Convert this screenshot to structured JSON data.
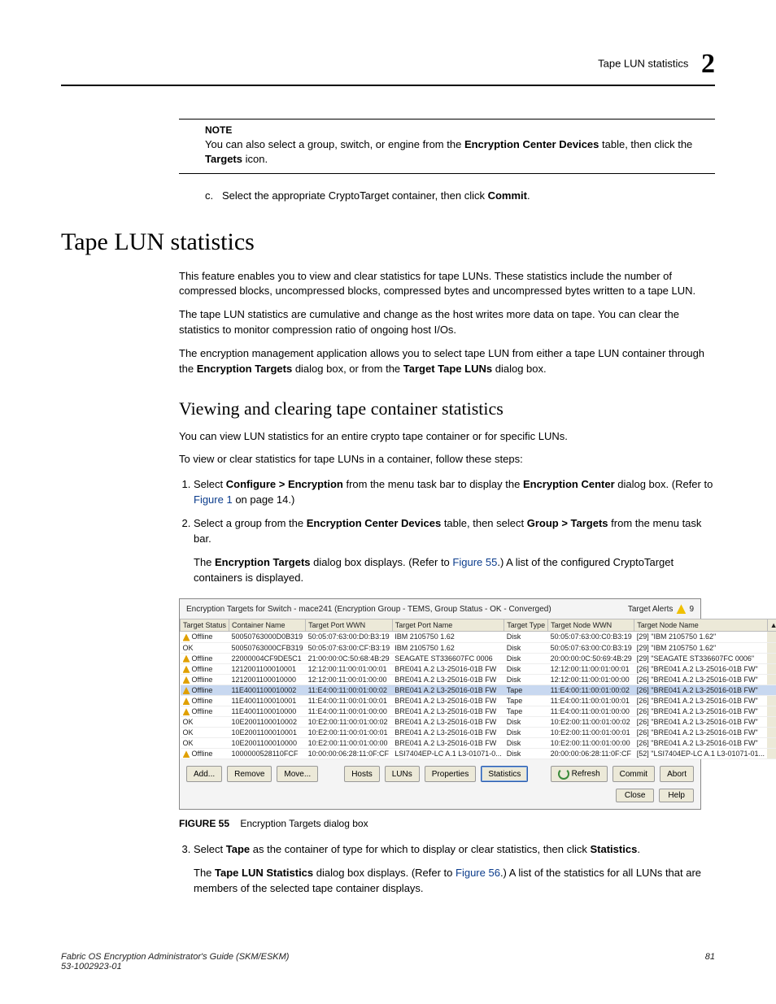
{
  "header": {
    "section": "Tape LUN statistics",
    "chapter": "2"
  },
  "note": {
    "label": "NOTE",
    "body_pre": "You can also select a group, switch, or engine from the ",
    "bold1": "Encryption Center Devices",
    "body_mid": " table, then click the ",
    "bold2": "Targets",
    "body_post": " icon."
  },
  "step_c": {
    "marker": "c.",
    "pre": "Select the appropriate CryptoTarget container, then click ",
    "bold": "Commit",
    "post": "."
  },
  "h1": "Tape LUN statistics",
  "p1": "This feature enables you to view and clear statistics for tape LUNs. These statistics include the number of compressed blocks, uncompressed blocks, compressed bytes and uncompressed bytes written to a tape LUN.",
  "p2": "The tape LUN statistics are cumulative and change as the host writes more data on tape. You can clear the statistics to monitor compression ratio of ongoing host I/Os.",
  "p3": {
    "pre": "The encryption management application allows you to select tape LUN from either a tape LUN container through the ",
    "b1": "Encryption Targets",
    "mid": " dialog box, or from the ",
    "b2": "Target Tape LUNs",
    "post": " dialog box."
  },
  "h2": "Viewing and clearing tape container statistics",
  "p4": "You can view LUN statistics for an entire crypto tape container or for specific LUNs.",
  "p5": "To view or clear statistics for tape LUNs in a container, follow these steps:",
  "steps": {
    "s1": {
      "pre": "Select ",
      "b1": "Configure > Encryption",
      "mid": " from the menu task bar to display the ",
      "b2": "Encryption Center",
      "mid2": " dialog box. (Refer to ",
      "link": "Figure 1",
      "post": " on page 14.)"
    },
    "s2": {
      "pre": "Select a group from the ",
      "b1": "Encryption Center Devices",
      "mid": " table, then select ",
      "b2": "Group > Targets",
      "post": " from the menu task bar.",
      "sub_pre": "The ",
      "sub_b": "Encryption Targets",
      "sub_mid": " dialog box displays. (Refer to ",
      "sub_link": "Figure 55",
      "sub_post": ".) A list of the configured CryptoTarget containers is displayed."
    },
    "s3": {
      "pre": "Select ",
      "b1": "Tape",
      "mid": " as the container of type for which to display or clear statistics, then click ",
      "b2": "Statistics",
      "post": ".",
      "sub_pre": "The ",
      "sub_b": "Tape LUN Statistics",
      "sub_mid": " dialog box displays. (Refer to ",
      "sub_link": "Figure 56",
      "sub_post": ".) A list of the statistics for all LUNs that are members of the selected tape container displays."
    }
  },
  "dialog": {
    "title": "Encryption Targets for Switch - mace241 (Encryption Group - TEMS, Group Status - OK - Converged)",
    "alerts_label": "Target Alerts",
    "alerts_count": "9",
    "columns": [
      "Target Status",
      "Container Name",
      "Target Port WWN",
      "Target Port Name",
      "Target Type",
      "Target Node WWN",
      "Target Node Name"
    ],
    "rows": [
      {
        "st": "Offline",
        "cn": "50050763000D0B319",
        "pw": "50:05:07:63:00:D0:B3:19",
        "pn": "IBM      2105750      1.62",
        "tt": "Disk",
        "nw": "50:05:07:63:00:C0:B3:19",
        "nn": "[29] \"IBM      2105750      1.62\""
      },
      {
        "st": "OK",
        "cn": "50050763000CFB319",
        "pw": "50:05:07:63:00:CF:B3:19",
        "pn": "IBM      2105750      1.62",
        "tt": "Disk",
        "nw": "50:05:07:63:00:C0:B3:19",
        "nn": "[29] \"IBM      2105750      1.62\""
      },
      {
        "st": "Offline",
        "cn": "22000004CF9DE5C1",
        "pw": "21:00:00:0C:50:68:4B:29",
        "pn": "SEAGATE ST336607FC          0006",
        "tt": "Disk",
        "nw": "20:00:00:0C:50:69:4B:29",
        "nn": "[29] \"SEAGATE ST336607FC    0006\""
      },
      {
        "st": "Offline",
        "cn": "1212001100010001",
        "pw": "12:12:00:11:00:01:00:01",
        "pn": "BRE041 A.2 L3-25016-01B FW",
        "tt": "Disk",
        "nw": "12:12:00:11:00:01:00:01",
        "nn": "[26] \"BRE041 A.2 L3-25016-01B FW\""
      },
      {
        "st": "Offline",
        "cn": "1212001100010000",
        "pw": "12:12:00:11:00:01:00:00",
        "pn": "BRE041 A.2 L3-25016-01B FW",
        "tt": "Disk",
        "nw": "12:12:00:11:00:01:00:00",
        "nn": "[26] \"BRE041 A.2 L3-25016-01B FW\""
      },
      {
        "st": "Offline",
        "sel": true,
        "cn": "11E4001100010002",
        "pw": "11:E4:00:11:00:01:00:02",
        "pn": "BRE041 A.2 L3-25016-01B FW",
        "tt": "Tape",
        "nw": "11:E4:00:11:00:01:00:02",
        "nn": "[26] \"BRE041 A.2 L3-25016-01B FW\""
      },
      {
        "st": "Offline",
        "cn": "11E4001100010001",
        "pw": "11:E4:00:11:00:01:00:01",
        "pn": "BRE041 A.2 L3-25016-01B FW",
        "tt": "Tape",
        "nw": "11:E4:00:11:00:01:00:01",
        "nn": "[26] \"BRE041 A.2 L3-25016-01B FW\""
      },
      {
        "st": "Offline",
        "cn": "11E4001100010000",
        "pw": "11:E4:00:11:00:01:00:00",
        "pn": "BRE041 A.2 L3-25016-01B FW",
        "tt": "Tape",
        "nw": "11:E4:00:11:00:01:00:00",
        "nn": "[26] \"BRE041 A.2 L3-25016-01B FW\""
      },
      {
        "st": "OK",
        "cn": "10E2001100010002",
        "pw": "10:E2:00:11:00:01:00:02",
        "pn": "BRE041 A.2 L3-25016-01B FW",
        "tt": "Disk",
        "nw": "10:E2:00:11:00:01:00:02",
        "nn": "[26] \"BRE041 A.2 L3-25016-01B FW\""
      },
      {
        "st": "OK",
        "cn": "10E2001100010001",
        "pw": "10:E2:00:11:00:01:00:01",
        "pn": "BRE041 A.2 L3-25016-01B FW",
        "tt": "Disk",
        "nw": "10:E2:00:11:00:01:00:01",
        "nn": "[26] \"BRE041 A.2 L3-25016-01B FW\""
      },
      {
        "st": "OK",
        "cn": "10E2001100010000",
        "pw": "10:E2:00:11:00:01:00:00",
        "pn": "BRE041 A.2 L3-25016-01B FW",
        "tt": "Disk",
        "nw": "10:E2:00:11:00:01:00:00",
        "nn": "[26] \"BRE041 A.2 L3-25016-01B FW\""
      },
      {
        "st": "Offline",
        "cn": "1000000528110FCF",
        "pw": "10:00:00:06:28:11:0F:CF",
        "pn": "LSI7404EP-LC A.1 L3-01071-0...",
        "tt": "Disk",
        "nw": "20:00:00:06:28:11:0F:CF",
        "nn": "[52] \"LSI7404EP-LC A.1 L3-01071-01..."
      }
    ],
    "buttons": {
      "add": "Add...",
      "remove": "Remove",
      "move": "Move...",
      "hosts": "Hosts",
      "luns": "LUNs",
      "properties": "Properties",
      "statistics": "Statistics",
      "refresh": "Refresh",
      "commit": "Commit",
      "abort": "Abort",
      "close": "Close",
      "help": "Help"
    }
  },
  "figcap": {
    "label": "FIGURE 55",
    "text": "Encryption Targets dialog box"
  },
  "footer": {
    "title": "Fabric OS Encryption Administrator's Guide (SKM/ESKM)",
    "doc": "53-1002923-01",
    "page": "81"
  }
}
